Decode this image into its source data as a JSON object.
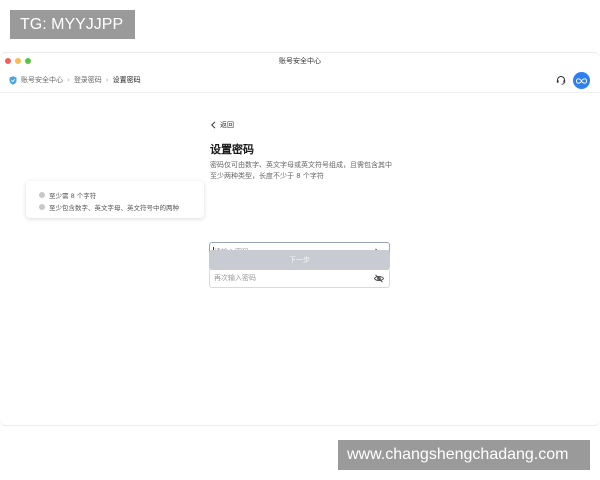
{
  "overlays": {
    "tg_text": "TG: MYYJJPP",
    "site_text": "www.changshengchadang.com"
  },
  "window": {
    "title": "账号安全中心"
  },
  "breadcrumb": {
    "items": [
      {
        "label": "账号安全中心",
        "icon": "shield-icon"
      },
      {
        "label": "登录密码"
      },
      {
        "label": "设置密码"
      }
    ]
  },
  "header_icons": {
    "support": "headset-icon",
    "avatar_text": "∞"
  },
  "form": {
    "back_label": "返回",
    "title": "设置密码",
    "description": "密码仅可由数字、英文字母或英文符号组成，且需包含其中至少两种类型，长度不少于 8 个字符",
    "password_placeholder": "请输入密码",
    "confirm_placeholder": "再次输入密码",
    "next_label": "下一步"
  },
  "rules": {
    "items": [
      "至少需 8 个字符",
      "至少包含数字、英文字母、英文符号中的两种"
    ]
  },
  "colors": {
    "accent": "#2f7ff0",
    "button_disabled": "#c8ccd2",
    "dot_red": "#f25f58",
    "dot_yellow": "#f6be4f",
    "dot_green": "#58c544"
  }
}
